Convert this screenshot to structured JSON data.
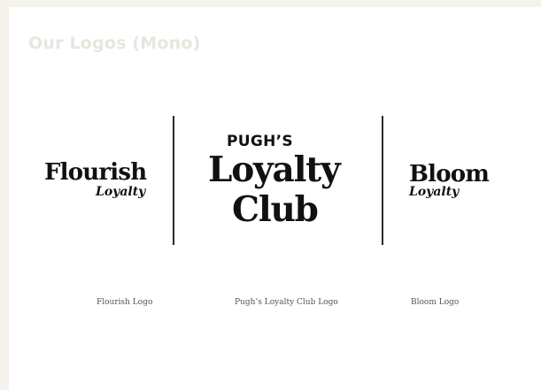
{
  "section": {
    "title": "Our Logos (Mono)"
  },
  "logos": [
    {
      "main": "Flourish",
      "sub": "Loyalty",
      "caption": "Flourish Logo"
    },
    {
      "top": "PUGH’S",
      "line1": "Loyalty",
      "line2": "Club",
      "caption": "Pugh’s Loyalty Club Logo"
    },
    {
      "main": "Bloom",
      "sub": "Loyalty",
      "caption": "Bloom Logo"
    }
  ],
  "colors": {
    "page_background": "#f6f3ec",
    "card_background": "#ffffff",
    "title_color": "#e9e5df",
    "logo_color": "#111111",
    "divider_color": "#2b2b2b"
  }
}
